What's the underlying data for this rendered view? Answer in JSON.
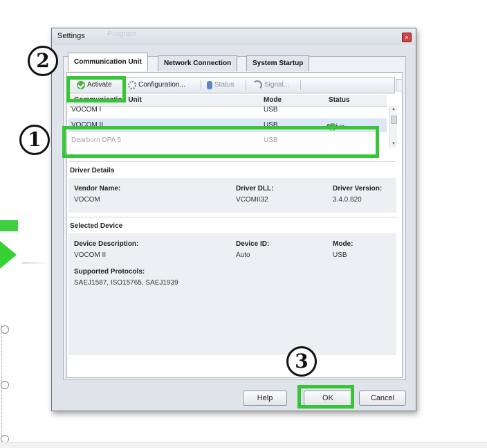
{
  "dialog": {
    "title": "Settings",
    "title_ghost": "Program",
    "close_label": "×"
  },
  "tabs": [
    {
      "label": "Communication Unit",
      "active": true
    },
    {
      "label": "Network Connection",
      "active": false
    },
    {
      "label": "System Startup",
      "active": false
    }
  ],
  "toolbar": {
    "activate": "Activate",
    "configuration": "Configuration...",
    "status": "Status",
    "signal": "Signal..."
  },
  "unit_table": {
    "headers": [
      "Communication Unit",
      "Mode",
      "Status"
    ],
    "rows": [
      {
        "unit": "VOCOM I",
        "mode": "USB",
        "status": ""
      },
      {
        "unit": "VOCOM II",
        "mode": "USB",
        "status": "Active"
      },
      {
        "unit": "Dearborn DPA 5",
        "mode": "USB",
        "status": ""
      }
    ]
  },
  "driver_details": {
    "heading": "Driver Details",
    "vendor_label": "Vendor Name:",
    "vendor_value": "VOCOM",
    "dll_label": "Driver DLL:",
    "dll_value": "VCOMII32",
    "version_label": "Driver Version:",
    "version_value": "3.4.0.820"
  },
  "selected_device": {
    "heading": "Selected Device",
    "desc_label": "Device Description:",
    "desc_value": "VOCOM II",
    "id_label": "Device ID:",
    "id_value": "Auto",
    "mode_label": "Mode:",
    "mode_value": "USB",
    "protocols_label": "Supported Protocols:",
    "protocols_value": "SAEJ1587, ISO15765, SAEJ1939"
  },
  "buttons": {
    "help": "Help",
    "ok": "OK",
    "cancel": "Cancel"
  },
  "annotations": {
    "step1": "1",
    "step2": "2",
    "step3": "3"
  },
  "colors": {
    "highlight": "#37c437",
    "active_check": "#4cb04c"
  }
}
